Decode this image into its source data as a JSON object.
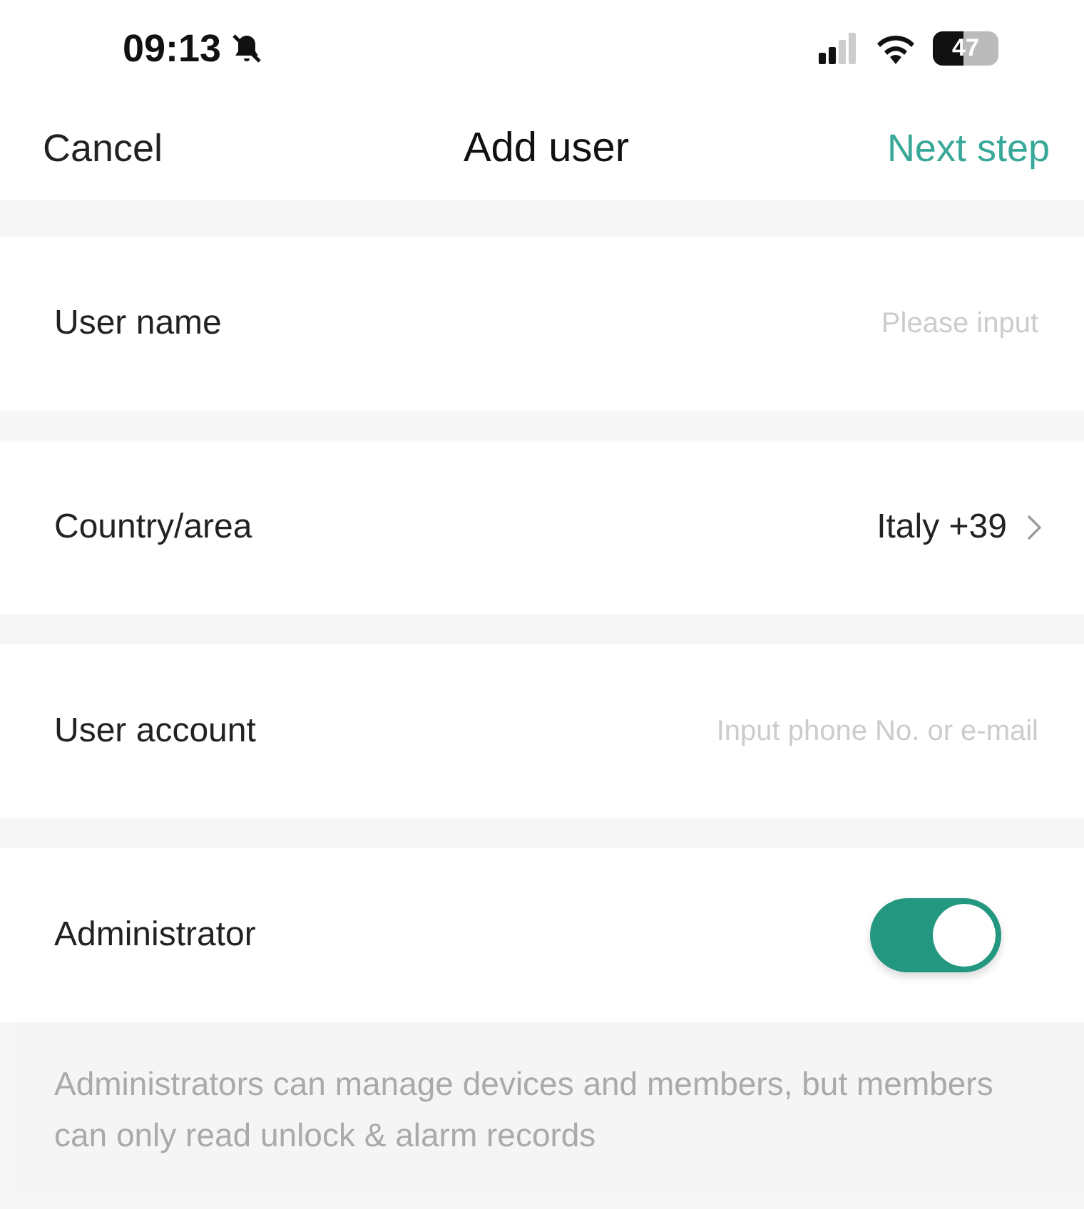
{
  "status_bar": {
    "time": "09:13",
    "silent": true,
    "battery": "47"
  },
  "nav": {
    "cancel": "Cancel",
    "title": "Add user",
    "next": "Next step"
  },
  "rows": [
    {
      "kind": "input",
      "label": "User name",
      "placeholder": "Please input"
    },
    {
      "kind": "select",
      "label": "Country/area",
      "value": "Italy +39"
    },
    {
      "kind": "input",
      "label": "User account",
      "placeholder": "Input phone No. or e-mail"
    },
    {
      "kind": "toggle",
      "label": "Administrator",
      "on": true
    }
  ],
  "note": "Administrators can manage devices and members, but members can only read unlock & alarm records"
}
